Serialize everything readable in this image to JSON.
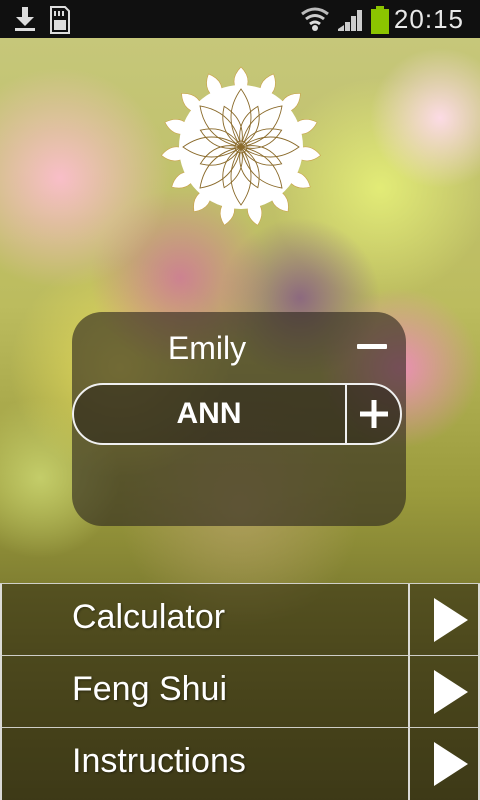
{
  "status_bar": {
    "time": "20:15",
    "icons": [
      "download-icon",
      "sd-card-icon",
      "wifi-icon",
      "signal-icon",
      "battery-icon"
    ],
    "battery_color": "#8bc400"
  },
  "logo": {
    "name": "lotus-mandala-logo"
  },
  "profile": {
    "name": "Emily",
    "value": "ANN",
    "minus_symbol": "−",
    "plus_symbol": "+"
  },
  "menu": {
    "items": [
      {
        "label": "Calculator"
      },
      {
        "label": "Feng Shui"
      },
      {
        "label": "Instructions"
      }
    ]
  },
  "colors": {
    "panel_bg": "#2d261e",
    "text": "#ffffff"
  }
}
